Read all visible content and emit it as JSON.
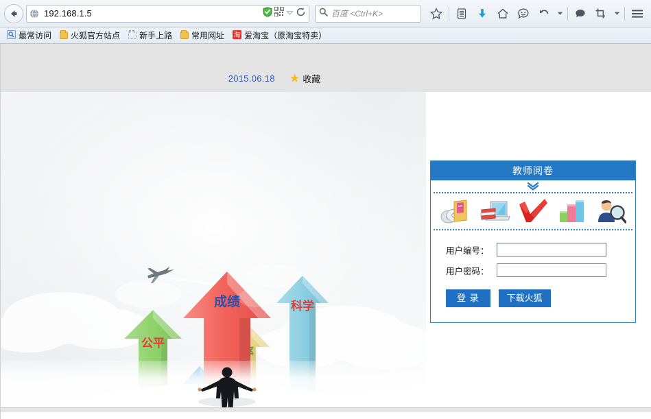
{
  "browser": {
    "back_button": "back-arrow",
    "url": "192.168.1.5",
    "url_favicon": "globe-icon",
    "shield": "shield-check-icon",
    "qr": "qr-code-icon",
    "reload": "reload-icon",
    "search_placeholder": "百度 <Ctrl+K>",
    "toolbar_icons": [
      {
        "name": "bookmark-star-icon",
        "glyph": "star"
      },
      {
        "name": "reading-list-icon",
        "glyph": "list"
      },
      {
        "name": "downloads-icon",
        "glyph": "download"
      },
      {
        "name": "home-icon",
        "glyph": "home"
      },
      {
        "name": "smiley-icon",
        "glyph": "smiley"
      },
      {
        "name": "undo-icon",
        "glyph": "undo"
      },
      {
        "name": "undo-dropdown-icon",
        "glyph": "caret"
      },
      {
        "name": "chat-bubble-icon",
        "glyph": "chat"
      },
      {
        "name": "screenshot-crop-icon",
        "glyph": "crop"
      },
      {
        "name": "crop-dropdown-icon",
        "glyph": "caret"
      },
      {
        "name": "menu-icon",
        "glyph": "hamburger"
      }
    ],
    "bookmarks": [
      {
        "label": "最常访问",
        "icon": "most-visited-icon"
      },
      {
        "label": "火狐官方站点",
        "icon": "folder-icon"
      },
      {
        "label": "新手上路",
        "icon": "folder-dashed-icon"
      },
      {
        "label": "常用网址",
        "icon": "folder-icon"
      },
      {
        "label": "爱淘宝（原淘宝特卖）",
        "icon": "taobao-icon"
      }
    ]
  },
  "page": {
    "header": {
      "date": "2015.06.18",
      "favorites_label": "收藏",
      "favorites_icon": "star-icon",
      "date_color": "#2b5bbd"
    },
    "hero": {
      "arrows": [
        {
          "label": "公平",
          "arrow_color": "#92d36e",
          "text_color": "#e0403a"
        },
        {
          "label": "成绩",
          "arrow_color": "#ef5a55",
          "text_color": "#2f4ea8"
        },
        {
          "label": "效率",
          "arrow_color": "#efd889",
          "text_color": "#4b9c3f"
        },
        {
          "label": "科学",
          "arrow_color": "#89cce0",
          "text_color": "#d8403a"
        },
        {
          "label": "",
          "arrow_color": "#6aaee8",
          "text_color": ""
        }
      ],
      "airplane": "airplane-icon",
      "figure": "businessman-silhouette"
    },
    "login": {
      "title": "教师阅卷",
      "chevron": "double-chevron-down-icon",
      "accent": "#2579c4",
      "icons": [
        {
          "name": "media-books-icon"
        },
        {
          "name": "laptop-books-icon"
        },
        {
          "name": "red-check-icon"
        },
        {
          "name": "bar-chart-icon"
        },
        {
          "name": "user-search-icon"
        }
      ],
      "fields": [
        {
          "label": "用户编号：",
          "value": "",
          "placeholder": "",
          "name": "user-id"
        },
        {
          "label": "用户密码：",
          "value": "",
          "placeholder": "",
          "name": "password"
        }
      ],
      "buttons": [
        {
          "label": "登 录",
          "name": "login-button"
        },
        {
          "label": "下载火狐",
          "name": "download-firefox-button"
        }
      ]
    }
  }
}
